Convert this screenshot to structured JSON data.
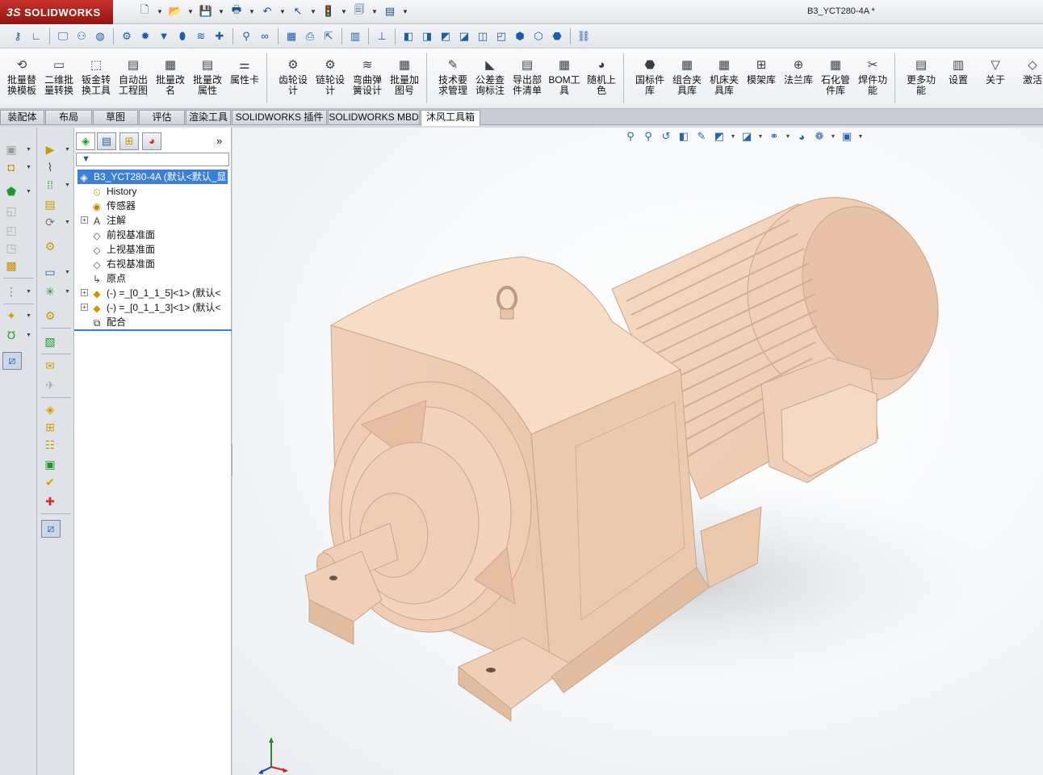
{
  "app": {
    "brand_mark": "3S",
    "brand_name": "SOLIDWORKS",
    "document_title": "B3_YCT280-4A *"
  },
  "quick_access": [
    {
      "icon": "new-document-icon",
      "glyph": "🗋"
    },
    {
      "icon": "open-folder-icon",
      "glyph": "📂"
    },
    {
      "icon": "save-icon",
      "glyph": "💾"
    },
    {
      "icon": "print-icon",
      "glyph": "🖶"
    },
    {
      "icon": "undo-icon",
      "glyph": "↶"
    },
    {
      "icon": "select-cursor-icon",
      "glyph": "↖"
    },
    {
      "icon": "rebuild-traffic-light-icon",
      "glyph": "🚦"
    },
    {
      "icon": "file-properties-icon",
      "glyph": "🗐"
    },
    {
      "icon": "options-icon",
      "glyph": "▤"
    }
  ],
  "command_groups": [
    [
      {
        "label1": "批量替",
        "label2": "换模板",
        "icon": "batch-replace-template-icon"
      },
      {
        "label1": "二维批",
        "label2": "量转换",
        "icon": "2d-batch-convert-icon"
      },
      {
        "label1": "钣金转",
        "label2": "换工具",
        "icon": "sheetmetal-convert-icon"
      },
      {
        "label1": "自动出",
        "label2": "工程图",
        "icon": "auto-drawing-icon"
      },
      {
        "label1": "批量改",
        "label2": "名",
        "icon": "batch-rename-icon"
      },
      {
        "label1": "批量改",
        "label2": "属性",
        "icon": "batch-properties-icon"
      },
      {
        "label1": "属性卡",
        "label2": "",
        "icon": "property-card-icon"
      }
    ],
    [
      {
        "label1": "齿轮设",
        "label2": "计",
        "icon": "gear-design-icon"
      },
      {
        "label1": "链轮设",
        "label2": "计",
        "icon": "sprocket-design-icon"
      },
      {
        "label1": "弯曲弹",
        "label2": "簧设计",
        "icon": "spring-design-icon"
      },
      {
        "label1": "批量加",
        "label2": "图号",
        "icon": "batch-drawing-number-icon"
      }
    ],
    [
      {
        "label1": "技术要",
        "label2": "求管理",
        "icon": "tech-requirements-icon"
      },
      {
        "label1": "公差查",
        "label2": "询标注",
        "icon": "tolerance-query-icon"
      },
      {
        "label1": "导出部",
        "label2": "件清单",
        "icon": "export-parts-list-icon"
      },
      {
        "label1": "BOM工",
        "label2": "具",
        "icon": "bom-tool-icon"
      },
      {
        "label1": "随机上",
        "label2": "色",
        "icon": "random-color-icon"
      }
    ],
    [
      {
        "label1": "国标件",
        "label2": "库",
        "icon": "standard-parts-library-icon"
      },
      {
        "label1": "组合夹",
        "label2": "具库",
        "icon": "fixture-library-icon"
      },
      {
        "label1": "机床夹",
        "label2": "具库",
        "icon": "machine-fixture-library-icon"
      },
      {
        "label1": "模架库",
        "label2": "",
        "icon": "mold-base-library-icon"
      },
      {
        "label1": "法兰库",
        "label2": "",
        "icon": "flange-library-icon"
      },
      {
        "label1": "石化管",
        "label2": "件库",
        "icon": "pipe-fittings-library-icon"
      },
      {
        "label1": "焊件功",
        "label2": "能",
        "icon": "weldment-icon"
      }
    ],
    [
      {
        "label1": "更多功",
        "label2": "能",
        "icon": "more-functions-icon"
      },
      {
        "label1": "设置",
        "label2": "",
        "icon": "settings-icon"
      },
      {
        "label1": "关于",
        "label2": "",
        "icon": "about-icon"
      },
      {
        "label1": "激活",
        "label2": "",
        "icon": "activate-icon"
      }
    ]
  ],
  "tabs": [
    {
      "label": "装配体",
      "active": false
    },
    {
      "label": "布局",
      "active": false
    },
    {
      "label": "草图",
      "active": false
    },
    {
      "label": "评估",
      "active": false
    },
    {
      "label": "渲染工具",
      "active": false
    },
    {
      "label": "SOLIDWORKS 插件",
      "active": false
    },
    {
      "label": "SOLIDWORKS MBD",
      "active": false
    },
    {
      "label": "沐风工具箱",
      "active": true
    }
  ],
  "feature_tree": {
    "expand_label": "»",
    "filter_glyph": "▼",
    "root_label": "B3_YCT280-4A  (默认<默认_显",
    "items": [
      {
        "label": "History",
        "icon": "history-icon",
        "glyph": "⏲",
        "expandable": false
      },
      {
        "label": "传感器",
        "icon": "sensors-icon",
        "glyph": "◉",
        "expandable": false
      },
      {
        "label": "注解",
        "icon": "annotations-icon",
        "glyph": "A",
        "expandable": true
      },
      {
        "label": "前视基准面",
        "icon": "front-plane-icon",
        "glyph": "◇",
        "expandable": false
      },
      {
        "label": "上视基准面",
        "icon": "top-plane-icon",
        "glyph": "◇",
        "expandable": false
      },
      {
        "label": "右视基准面",
        "icon": "right-plane-icon",
        "glyph": "◇",
        "expandable": false
      },
      {
        "label": "原点",
        "icon": "origin-icon",
        "glyph": "↳",
        "expandable": false
      },
      {
        "label": "(-) =_[0_1_1_5]<1> (默认<",
        "icon": "component-icon",
        "glyph": "◆",
        "expandable": true
      },
      {
        "label": "(-) =_[0_1_1_3]<1> (默认<",
        "icon": "component-icon",
        "glyph": "◆",
        "expandable": true
      },
      {
        "label": "配合",
        "icon": "mates-icon",
        "glyph": "⧉",
        "expandable": false
      }
    ]
  },
  "colors": {
    "model_body": "#f3d3bb",
    "model_shade": "#d9b69c",
    "model_dark": "#bf9a80",
    "selection": "#3c80d6",
    "brand_red": "#b8241f"
  }
}
